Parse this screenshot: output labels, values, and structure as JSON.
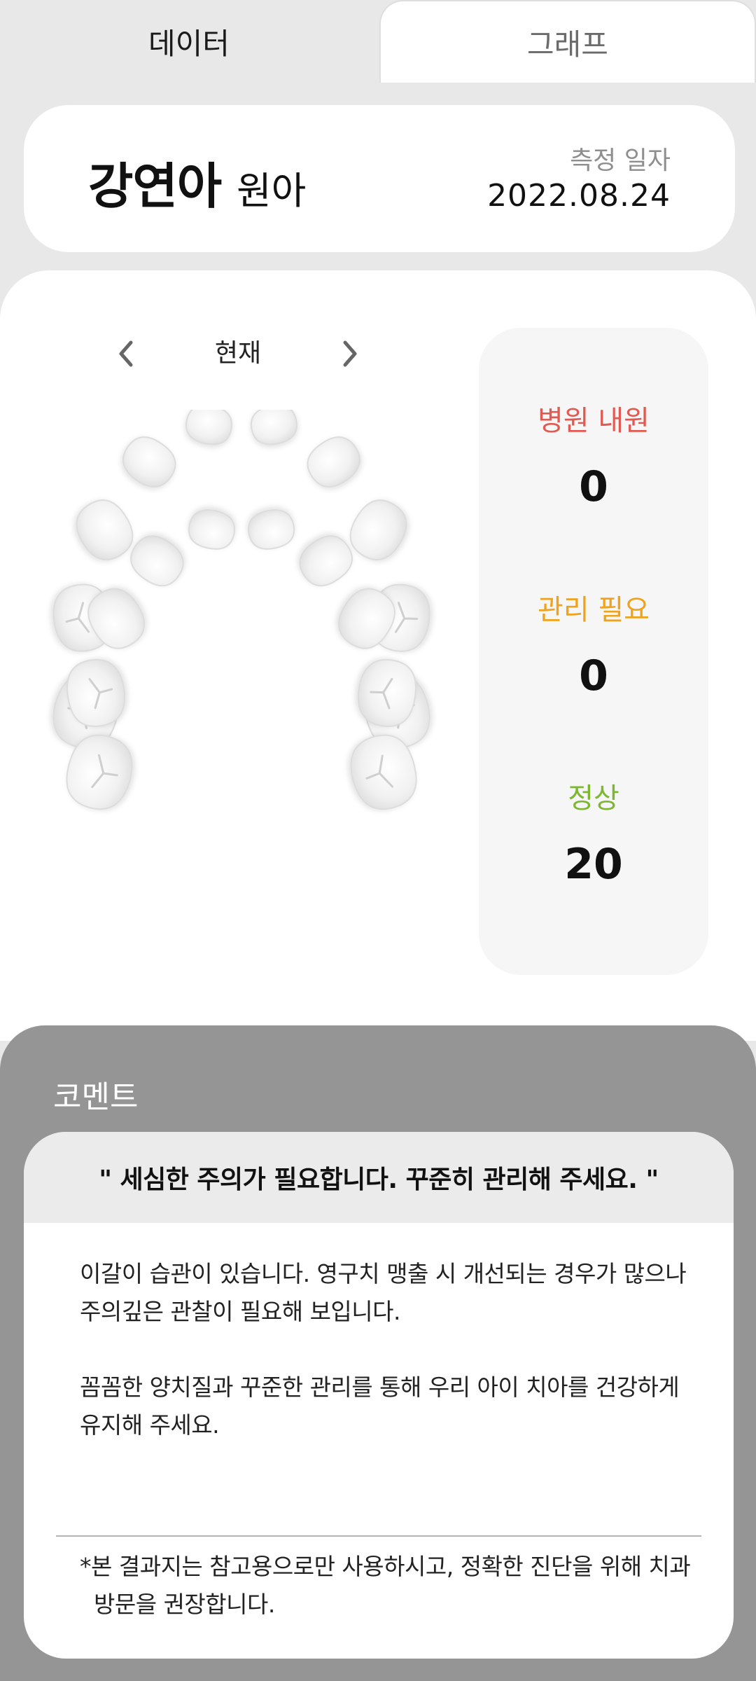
{
  "tabs": {
    "data_label": "데이터",
    "graph_label": "그래프"
  },
  "profile": {
    "name": "강연아",
    "suffix": "원아",
    "date_label": "측정 일자",
    "date_value": "2022.08.24"
  },
  "period": {
    "label": "현재"
  },
  "teeth": {
    "upper_count": 10,
    "lower_count": 10
  },
  "stats": {
    "hospital": {
      "label": "병원 내원",
      "value": "0",
      "color": "#e05a52"
    },
    "care": {
      "label": "관리 필요",
      "value": "0",
      "color": "#efa31c"
    },
    "normal": {
      "label": "정상",
      "value": "20",
      "color": "#7cb82f"
    }
  },
  "comment": {
    "title": "코멘트",
    "headline": "\" 세심한 주의가 필요합니다. 꾸준히 관리해 주세요. \"",
    "paragraph1": "이갈이 습관이 있습니다. 영구치 맹출 시 개선되는 경우가 많으나 주의깊은 관찰이 필요해 보입니다.",
    "paragraph2": "꼼꼼한 양치질과 꾸준한 관리를 통해 우리 아이 치아를 건강하게 유지해 주세요.",
    "disclaimer": "*본 결과지는 참고용으로만 사용하시고, 정확한 진단을 위해 치과 방문을 권장합니다."
  },
  "colors": {
    "tooth_fill": "#f3f3f3",
    "tooth_stroke": "#dcdcdc",
    "comment_bg": "#959595"
  }
}
